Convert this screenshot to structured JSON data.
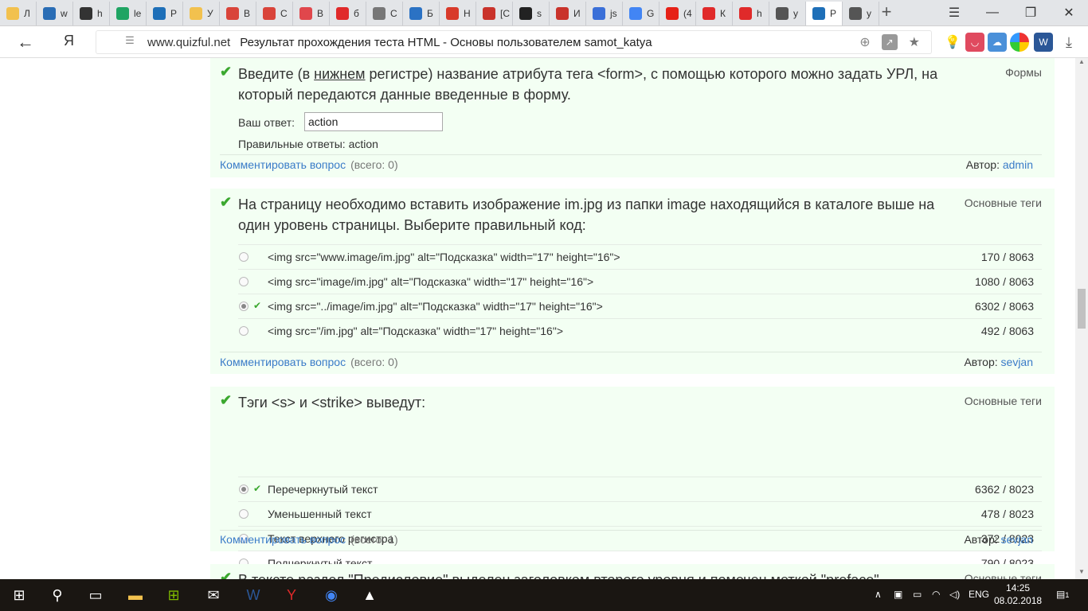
{
  "tabs": [
    {
      "label": "Л",
      "color": "#f2c14e"
    },
    {
      "label": "w",
      "color": "#2a6db5"
    },
    {
      "label": "h",
      "color": "#333333"
    },
    {
      "label": "le",
      "color": "#1fa463"
    },
    {
      "label": "Р",
      "color": "#1e6fb8"
    },
    {
      "label": "У",
      "color": "#f2c14e"
    },
    {
      "label": "В",
      "color": "#d9443a"
    },
    {
      "label": "С",
      "color": "#d9443a"
    },
    {
      "label": "В",
      "color": "#e0474c"
    },
    {
      "label": "б",
      "color": "#e02a2a"
    },
    {
      "label": "С",
      "color": "#777777"
    },
    {
      "label": "Б",
      "color": "#2b72c4"
    },
    {
      "label": "Н",
      "color": "#d83a2a"
    },
    {
      "label": "[С",
      "color": "#c9332b"
    },
    {
      "label": "s",
      "color": "#222222"
    },
    {
      "label": "И",
      "color": "#c9332b"
    },
    {
      "label": "js",
      "color": "#3a6fd8"
    },
    {
      "label": "G",
      "color": "#4285f4"
    },
    {
      "label": "(4",
      "color": "#e62117"
    },
    {
      "label": "К",
      "color": "#e02a2a"
    },
    {
      "label": "h",
      "color": "#e02a2a"
    },
    {
      "label": "у",
      "color": "#555555"
    },
    {
      "label": "Р",
      "color": "#1e6fb8"
    },
    {
      "label": "у",
      "color": "#555555"
    }
  ],
  "address": {
    "domain": "www.quizful.net",
    "title": "Результат прохождения теста HTML - Основы пользователем samot_katya"
  },
  "questions": [
    {
      "text_before": "Введите (в ",
      "text_underlined": "нижнем",
      "text_after": " регистре) название атрибута тега <form>, с помощью которого можно задать УРЛ, на который передаются данные введенные в форму.",
      "category": "Формы",
      "answer_label": "Ваш ответ:",
      "answer_value": "action",
      "correct_answers": "Правильные ответы: action",
      "comment_label": "Комментировать вопрос",
      "comment_count": "(всего: 0)",
      "author_label": "Автор:",
      "author": "admin"
    },
    {
      "text": "На страницу необходимо вставить изображение im.jpg из папки image находящийся в каталоге выше на один уровень страницы. Выберите правильный код:",
      "category": "Основные теги",
      "options": [
        {
          "text": "<img src=\"www.image/im.jpg\" alt=\"Подсказка\" width=\"17\" height=\"16\">",
          "stat": "170 / 8063",
          "selected": false,
          "correct": false
        },
        {
          "text": "<img src=\"image/im.jpg\" alt=\"Подсказка\" width=\"17\" height=\"16\">",
          "stat": "1080 / 8063",
          "selected": false,
          "correct": false
        },
        {
          "text": "<img src=\"../image/im.jpg\" alt=\"Подсказка\" width=\"17\" height=\"16\">",
          "stat": "6302 / 8063",
          "selected": true,
          "correct": true
        },
        {
          "text": "<img src=\"/im.jpg\" alt=\"Подсказка\" width=\"17\" height=\"16\">",
          "stat": "492 / 8063",
          "selected": false,
          "correct": false
        }
      ],
      "comment_label": "Комментировать вопрос",
      "comment_count": "(всего: 0)",
      "author_label": "Автор:",
      "author": "sevjan"
    },
    {
      "text": "Тэги <s> и <strike> выведут:",
      "category": "Основные теги",
      "options": [
        {
          "text": "Перечеркнутый текст",
          "stat": "6362 / 8023",
          "selected": true,
          "correct": true
        },
        {
          "text": "Уменьшенный текст",
          "stat": "478 / 8023",
          "selected": false,
          "correct": false
        },
        {
          "text": "Текст верхнего регистра",
          "stat": "372 / 8023",
          "selected": false,
          "correct": false
        },
        {
          "text": "Подчеркнутый текст",
          "stat": "790 / 8023",
          "selected": false,
          "correct": false
        }
      ],
      "comment_label": "Комментировать вопрос",
      "comment_count": "(всего: 1)",
      "author_label": "Автор:",
      "author": "sevjan"
    },
    {
      "text": "В тексте раздел \"Предисловие\" выделен заголовком второго уровня и помечен меткой \"preface\"",
      "category": "Основные теги"
    }
  ],
  "taskbar": {
    "lang": "ENG",
    "time": "14:25",
    "date": "08.02.2018",
    "notif_count": "1"
  }
}
